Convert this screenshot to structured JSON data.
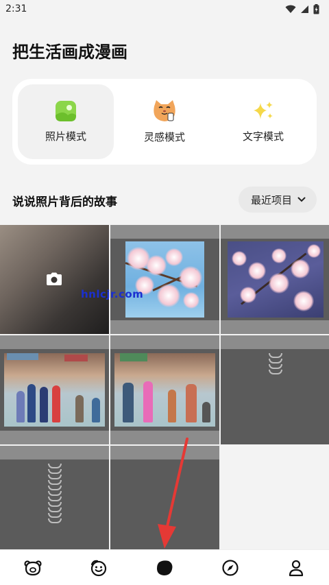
{
  "status": {
    "time": "2:31"
  },
  "header": {
    "title": "把生活画成漫画"
  },
  "modes": [
    {
      "label": "照片模式",
      "icon": "photo-mode-icon",
      "active": true
    },
    {
      "label": "灵感模式",
      "icon": "cat-face-icon",
      "active": false
    },
    {
      "label": "文字模式",
      "icon": "sparkles-icon",
      "active": false
    }
  ],
  "section": {
    "title": "说说照片背后的故事",
    "filter_label": "最近项目"
  },
  "watermark": "hnlcjr.com",
  "grid": [
    {
      "kind": "camera",
      "icon": "camera-icon"
    },
    {
      "kind": "cherry-sky"
    },
    {
      "kind": "cherry-purple"
    },
    {
      "kind": "game-scene-1"
    },
    {
      "kind": "game-scene-2"
    },
    {
      "kind": "loading"
    },
    {
      "kind": "loading"
    },
    {
      "kind": "loading"
    }
  ],
  "tabbar": [
    {
      "name": "tab-home",
      "icon": "bear-face-icon"
    },
    {
      "name": "tab-social",
      "icon": "smile-face-icon"
    },
    {
      "name": "tab-create",
      "icon": "blob-icon",
      "active": true
    },
    {
      "name": "tab-discover",
      "icon": "compass-icon"
    },
    {
      "name": "tab-profile",
      "icon": "user-icon"
    }
  ],
  "colors": {
    "accent": "#ffffff",
    "annotation_arrow": "#e53935",
    "tab_active": "#111111"
  }
}
